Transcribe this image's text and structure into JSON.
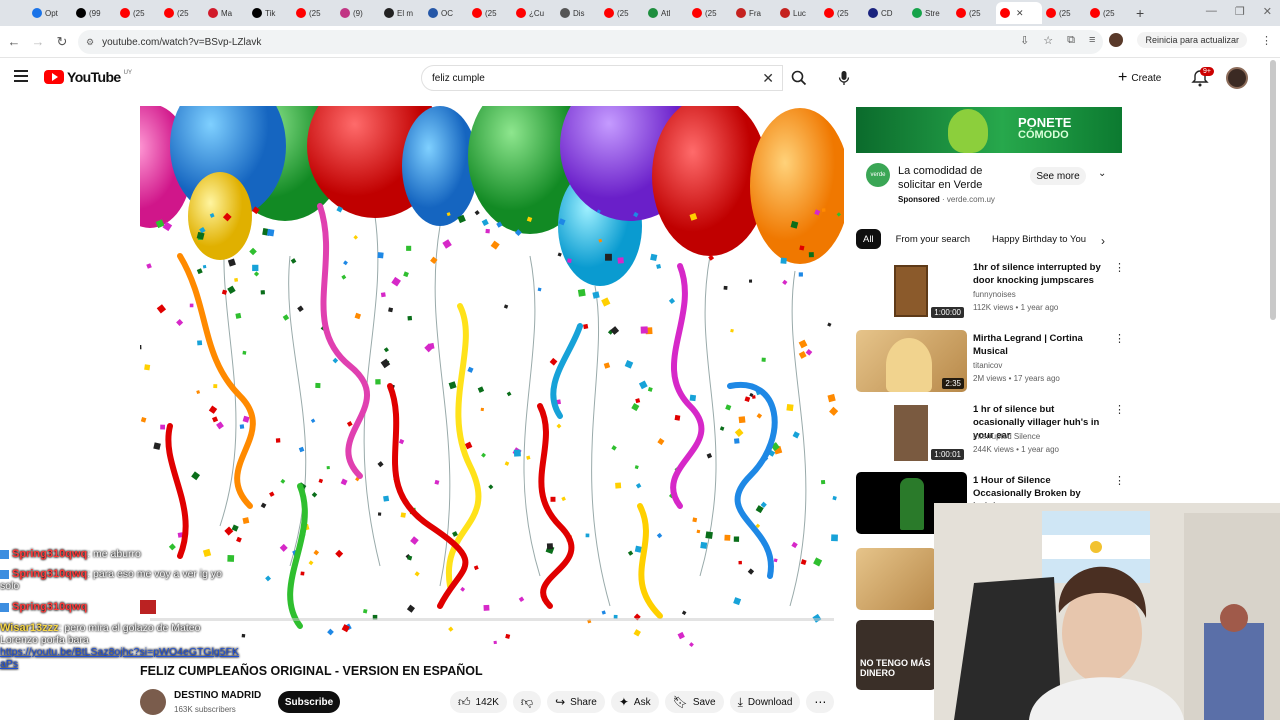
{
  "browser": {
    "tabs": [
      {
        "label": "Opt",
        "color": "#1a73e8"
      },
      {
        "label": "(99",
        "color": "#000000"
      },
      {
        "label": "(25",
        "color": "#ff0000"
      },
      {
        "label": "(25",
        "color": "#ff0000"
      },
      {
        "label": "Ma",
        "color": "#d11a2a"
      },
      {
        "label": "Tik",
        "color": "#000000"
      },
      {
        "label": "(25",
        "color": "#ff0000"
      },
      {
        "label": "(9)",
        "color": "#c13584"
      },
      {
        "label": "El m",
        "color": "#222222"
      },
      {
        "label": "OC",
        "color": "#2557a7"
      },
      {
        "label": "(25",
        "color": "#ff0000"
      },
      {
        "label": "¿Cu",
        "color": "#ff0000"
      },
      {
        "label": "Dis",
        "color": "#555555"
      },
      {
        "label": "(25",
        "color": "#ff0000"
      },
      {
        "label": "Atl",
        "color": "#1e8e3e"
      },
      {
        "label": "(25",
        "color": "#ff0000"
      },
      {
        "label": "Fra",
        "color": "#c5221f"
      },
      {
        "label": "Luc",
        "color": "#c5221f"
      },
      {
        "label": "(25",
        "color": "#ff0000"
      },
      {
        "label": "CD",
        "color": "#1a237e"
      },
      {
        "label": "Stre",
        "color": "#16a34a"
      },
      {
        "label": "(25",
        "color": "#ff0000"
      },
      {
        "label": "",
        "color": "#ff0000",
        "active": true
      },
      {
        "label": "(25",
        "color": "#ff0000"
      },
      {
        "label": "(25",
        "color": "#ff0000"
      }
    ],
    "url": "youtube.com/watch?v=BSvp-LZlavk",
    "relaunch": "Reinicia para actualizar"
  },
  "header": {
    "logo_text": "YouTube",
    "logo_country": "UY",
    "search_value": "feliz cumple",
    "create_label": "Create",
    "notifications": "9+"
  },
  "video": {
    "title": "FELIZ CUMPLEAÑOS ORIGINAL - VERSION EN ESPAÑOL",
    "channel": "DESTINO MADRID",
    "subscribers": "163K subscribers",
    "subscribe_label": "Subscribe",
    "likes": "142K",
    "share_label": "Share",
    "ask_label": "Ask",
    "save_label": "Save",
    "download_label": "Download"
  },
  "chat": [
    {
      "user": "Spring310qwq",
      "text": ": me aburro"
    },
    {
      "user": "Spring310qwq",
      "text": ": para eso me voy a ver ig yo solo"
    },
    {
      "user": "Spring310qwq",
      "text": ""
    },
    {
      "user": "Wisar13zzz",
      "text": ": pero mira el golazo de Mateo Lorenzo porfa bara",
      "link": "https://youtu.be/BtLSaz8ojhc?si=pWO4eGTGlg5FKaPs"
    }
  ],
  "ad": {
    "banner_line1": "PONETE",
    "banner_line2": "CÓMODO",
    "logo_text": "verde",
    "title": "La comodidad de solicitar en Verde",
    "sponsored": "Sponsored",
    "domain": "verde.com.uy",
    "see_more": "See more"
  },
  "chips": [
    "All",
    "From your search",
    "Happy Birthday to You"
  ],
  "recommendations": [
    {
      "title": "1hr of silence interrupted by door knocking jumpscares",
      "channel": "funnynoises",
      "meta": "112K views • 1 year ago",
      "duration": "1:00:00"
    },
    {
      "title": "Mirtha Legrand | Cortina Musical",
      "channel": "titanicov",
      "meta": "2M views • 17 years ago",
      "duration": "2:35"
    },
    {
      "title": "1 hr of silence but ocasionally villager huh's in your ear",
      "channel": "Interrupted Silence",
      "meta": "244K views • 1 year ago",
      "duration": "1:00:01"
    },
    {
      "title": "1 Hour of Silence Occasionally Broken by Luigi",
      "channel": "",
      "meta": "",
      "duration": ""
    }
  ],
  "partial_thumb_text": "NO TENGO MÁS DINERO",
  "colors": {
    "brand_red": "#ff0000",
    "subscribe_bg": "#0f0f0f",
    "chip_active": "#0f0f0f",
    "chat_user": "#ff3b3b"
  }
}
